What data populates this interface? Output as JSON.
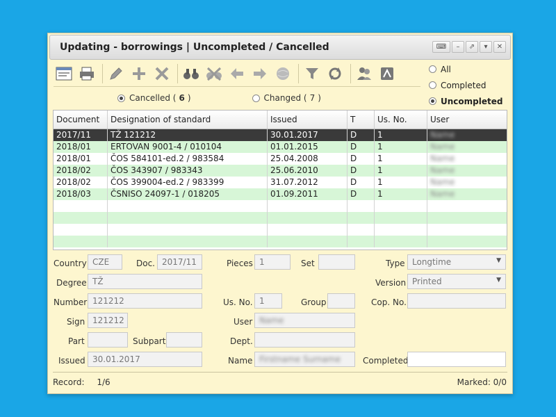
{
  "window": {
    "title": "Updating - borrowings | Uncompleted / Cancelled"
  },
  "toolbar_icons": [
    "form-icon",
    "print-icon",
    "edit-icon",
    "add-icon",
    "delete-icon",
    "find-icon",
    "clear-filter-icon",
    "back-icon",
    "forward-icon",
    "web-icon",
    "filter-icon",
    "refresh-icon",
    "users-icon",
    "pdf-icon"
  ],
  "filter": {
    "all": "All",
    "completed": "Completed",
    "uncompleted": "Uncompleted"
  },
  "subtabs": {
    "cancelled_label": "Cancelled (",
    "cancelled_count": "6",
    "changed_label": "Changed (",
    "changed_count": "7",
    "close_paren": ")"
  },
  "table": {
    "headers": [
      "Document",
      "Designation of standard",
      "Issued",
      "T",
      "Us. No.",
      "User"
    ],
    "rows": [
      [
        "2017/11",
        "TŽ 121212",
        "30.01.2017",
        "D",
        "1",
        "Name"
      ],
      [
        "2018/01",
        "ERTOVAN 9001-4 / 010104",
        "01.01.2015",
        "D",
        "1",
        "Name"
      ],
      [
        "2018/01",
        "ČOS 584101-ed.2 / 983584",
        "25.04.2008",
        "D",
        "1",
        "Name"
      ],
      [
        "2018/02",
        "ČOS 343907 / 983343",
        "25.06.2010",
        "D",
        "1",
        "Name"
      ],
      [
        "2018/02",
        "ČOS 399004-ed.2 / 983399",
        "31.07.2012",
        "D",
        "1",
        "Name"
      ],
      [
        "2018/03",
        "ČSNISO 24097-1 / 018205",
        "01.09.2011",
        "D",
        "1",
        "Name"
      ]
    ]
  },
  "form": {
    "country_label": "Country",
    "country_value": "CZE",
    "doc_label": "Doc.",
    "doc_value": "2017/11",
    "pieces_label": "Pieces",
    "pieces_value": "1",
    "set_label": "Set",
    "set_value": "",
    "type_label": "Type",
    "type_value": "Longtime",
    "degree_label": "Degree",
    "degree_value": "TŽ",
    "version_label": "Version",
    "version_value": "Printed",
    "number_label": "Number",
    "number_value": "121212",
    "usno_label": "Us. No.",
    "usno_value": "1",
    "group_label": "Group",
    "group_value": "",
    "copno_label": "Cop. No.",
    "copno_value": "",
    "sign_label": "Sign",
    "sign_value": "121212",
    "user_label": "User",
    "user_value": "Name",
    "part_label": "Part",
    "part_value": "",
    "subpart_label": "Subpart",
    "subpart_value": "",
    "dept_label": "Dept.",
    "dept_value": "",
    "issued_label": "Issued",
    "issued_value": "30.01.2017",
    "name_label": "Name",
    "name_value": "Firstname Surname",
    "completed_label": "Completed",
    "completed_value": ""
  },
  "status": {
    "record_label": "Record:",
    "record_value": "1/6",
    "marked": "Marked: 0/0"
  }
}
